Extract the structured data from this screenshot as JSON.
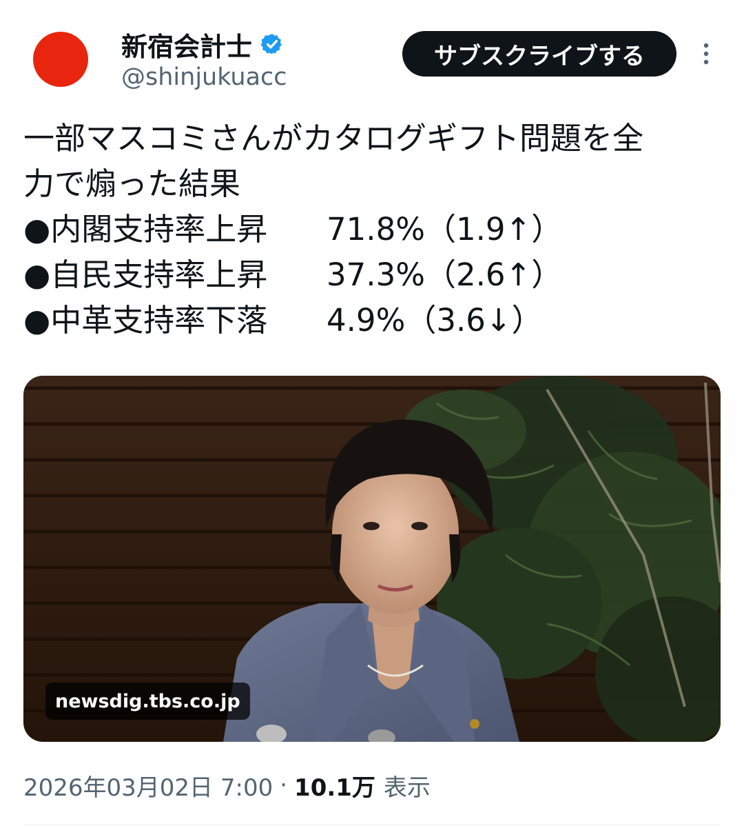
{
  "post": {
    "author": {
      "display_name": "新宿会計士",
      "handle": "@shinjukuacc",
      "verified": true,
      "avatar_color": "#e8260f"
    },
    "subscribe_label": "サブスクライブする",
    "text_lines": [
      "一部マスコミさんがカタログギフト問題を全",
      "力で煽った結果"
    ],
    "stats": [
      {
        "label": "●内閣支持率上昇",
        "value": "71.8%（1.9↑）"
      },
      {
        "label": "●自民支持率上昇",
        "value": "37.3%（2.6↑）"
      },
      {
        "label": "●中革支持率下落",
        "value": "4.9%（3.6↓）"
      }
    ],
    "media": {
      "source_label": "newsdig.tbs.co.jp"
    },
    "meta": {
      "datetime": "2026年03月02日 7:00",
      "separator": "·",
      "view_count": "10.1万",
      "view_label": "表示"
    }
  },
  "icons": {
    "verified": "verified-badge-icon",
    "more": "more-options-icon"
  },
  "colors": {
    "text": "#0f1419",
    "secondary_text": "#536471",
    "verified_blue": "#1d9bf0",
    "button_bg": "#0f1419"
  }
}
